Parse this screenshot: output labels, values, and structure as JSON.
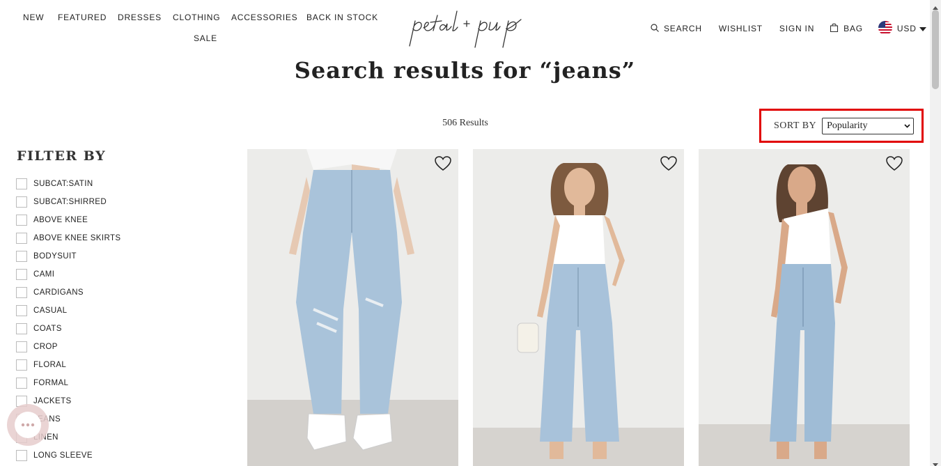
{
  "header": {
    "nav": [
      "NEW",
      "FEATURED",
      "DRESSES",
      "CLOTHING",
      "ACCESSORIES",
      "BACK IN STOCK",
      "SALE"
    ],
    "logo_text": "petal + pup",
    "search_label": "SEARCH",
    "wishlist_label": "WISHLIST",
    "signin_label": "SIGN IN",
    "bag_label": "BAG",
    "currency_label": "USD"
  },
  "page": {
    "title": "Search results for “jeans”",
    "results_count": "506 Results"
  },
  "sort": {
    "label": "SORT BY",
    "selected": "Popularity",
    "highlight_color": "#e10000"
  },
  "filter": {
    "title": "FILTER BY",
    "items": [
      "SUBCAT:SATIN",
      "SUBCAT:SHIRRED",
      "ABOVE KNEE",
      "ABOVE KNEE SKIRTS",
      "BODYSUIT",
      "CAMI",
      "CARDIGANS",
      "CASUAL",
      "COATS",
      "CROP",
      "FLORAL",
      "FORMAL",
      "JACKETS",
      "JEANS",
      "LINEN",
      "LONG SLEEVE"
    ]
  },
  "products": [
    {
      "name": "product-1",
      "image": "jeans-model-image",
      "wishlist_icon": "heart-icon"
    },
    {
      "name": "product-2",
      "image": "jeans-model-image",
      "wishlist_icon": "heart-icon"
    },
    {
      "name": "product-3",
      "image": "jeans-model-image",
      "wishlist_icon": "heart-icon"
    }
  ],
  "colors": {
    "text": "#222222",
    "denim": "#a9c3da",
    "backdrop": "#ececea",
    "floor": "#d3d0cc"
  }
}
